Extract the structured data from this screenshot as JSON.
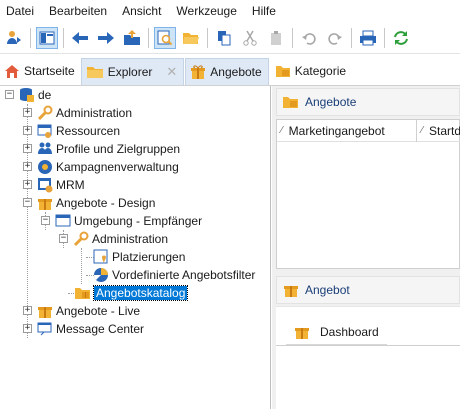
{
  "menu": [
    "Datei",
    "Bearbeiten",
    "Ansicht",
    "Werkzeuge",
    "Hilfe"
  ],
  "tabs": {
    "home": "Startseite",
    "explorer": "Explorer",
    "angebote": "Angebote",
    "kategorie": "Kategorie",
    "close_glyph": "✕"
  },
  "tree": {
    "root": "de",
    "items": [
      "Administration",
      "Ressourcen",
      "Profile und Zielgruppen",
      "Kampagnenverwaltung",
      "MRM",
      "Angebote - Design",
      "Umgebung - Empfänger",
      "Administration",
      "Platzierungen",
      "Vordefinierte Angebotsfilter",
      "Angebotskatalog",
      "Angebote - Live",
      "Message Center"
    ]
  },
  "right": {
    "top_title": "Angebote",
    "col1": "Marketingangebot",
    "col2": "Startd",
    "bottom_title": "Angebot",
    "dashboard": "Dashboard"
  },
  "colors": {
    "accent": "#0078d7",
    "folder": "#f2b233",
    "link_blue": "#1a3e78"
  }
}
